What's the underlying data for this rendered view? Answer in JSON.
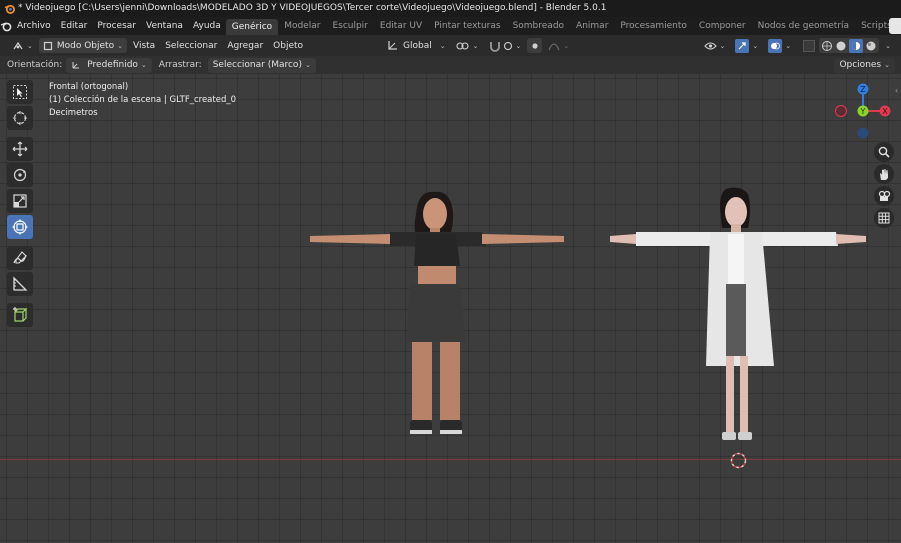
{
  "window": {
    "title": "* Videojuego [C:\\Users\\jenni\\Downloads\\MODELADO 3D Y VIDEOJUEGOS\\Tercer corte\\Videojuego\\Videojuego.blend] - Blender 5.0.1",
    "icon": "blender-icon"
  },
  "menu": {
    "items": [
      "Archivo",
      "Editar",
      "Procesar",
      "Ventana",
      "Ayuda"
    ],
    "workspaces": [
      "Genérico",
      "Modelar",
      "Esculpir",
      "Editar UV",
      "Pintar texturas",
      "Sombreado",
      "Animar",
      "Procesamiento",
      "Componer",
      "Nodos de geometría",
      "Scripts"
    ],
    "active_workspace": "Genérico",
    "add_workspace": "+"
  },
  "header": {
    "mode": "Modo Objeto",
    "menus": [
      "Vista",
      "Seleccionar",
      "Agregar",
      "Objeto"
    ],
    "transform_orientation": "Global"
  },
  "tool_settings": {
    "orientation_label": "Orientación:",
    "orientation_value": "Predefinido",
    "drag_label": "Arrastrar:",
    "drag_value": "Seleccionar (Marco)",
    "options": "Opciones"
  },
  "viewport": {
    "view_name": "Frontal (ortogonal)",
    "collection": "(1) Colección de la escena | GLTF_created_0",
    "units": "Decimetros"
  },
  "gizmo": {
    "z": "Z",
    "y": "Y",
    "x": "X",
    "colors": {
      "x": "#e03a4f",
      "y": "#8bd12a",
      "z": "#2f7ee0"
    }
  },
  "toolbar_icons": [
    "select-box-icon",
    "cursor-icon",
    "move-icon",
    "rotate-icon",
    "scale-icon",
    "transform-icon",
    "annotate-icon",
    "measure-icon",
    "add-cube-icon"
  ],
  "nav_icons": [
    "zoom-icon",
    "pan-hand-icon",
    "camera-icon",
    "grid-icon"
  ],
  "colors": {
    "accent": "#4a74b5",
    "floor_line": "#7a3a3a"
  }
}
